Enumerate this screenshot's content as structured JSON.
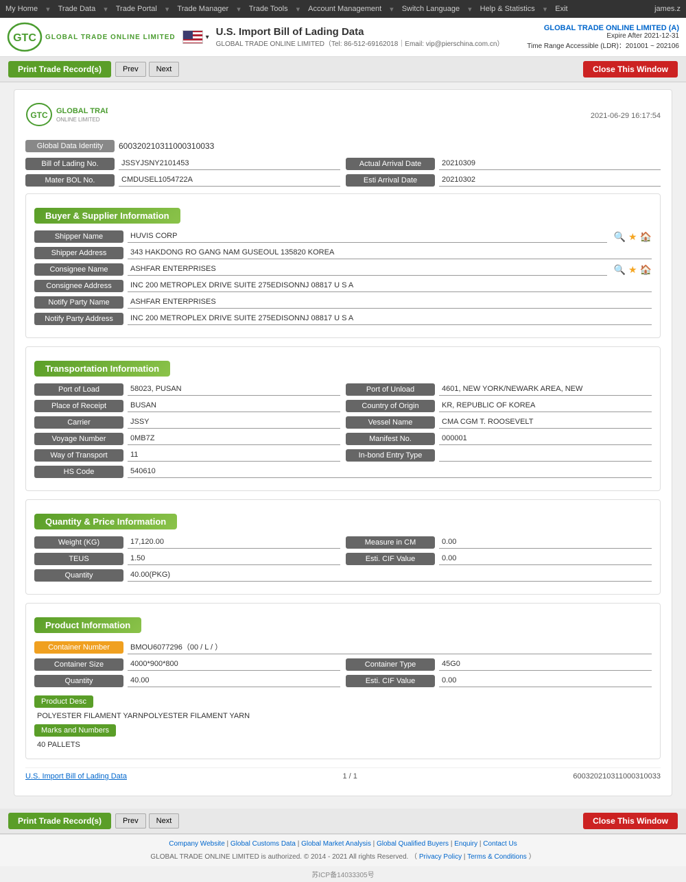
{
  "topnav": {
    "items": [
      "My Home",
      "Trade Data",
      "Trade Portal",
      "Trade Manager",
      "Trade Tools",
      "Account Management",
      "Switch Language",
      "Help & Statistics",
      "Exit"
    ],
    "user": "james.z"
  },
  "header": {
    "logo_text": "GTC",
    "logo_sub": "GLOBAL TRADE ONLINE LIMITED",
    "flag_alt": "US Flag",
    "title": "U.S. Import Bill of Lading Data",
    "subtitle": "GLOBAL TRADE ONLINE LIMITED（Tel: 86-512-69162018｜Email: vip@pierschina.com.cn）",
    "company_link": "GLOBAL TRADE ONLINE LIMITED (A)",
    "expire": "Expire After 2021-12-31",
    "time_range": "Time Range Accessible (LDR)：201001 ~ 202106"
  },
  "toolbar": {
    "print_label": "Print Trade Record(s)",
    "prev_label": "Prev",
    "next_label": "Next",
    "close_label": "Close This Window"
  },
  "record": {
    "datetime": "2021-06-29 16:17:54",
    "global_data_identity_label": "Global Data Identity",
    "global_data_identity_value": "600320210311000310033",
    "bol_no_label": "Bill of Lading No.",
    "bol_no_value": "JSSYJSNY2101453",
    "actual_arrival_label": "Actual Arrival Date",
    "actual_arrival_value": "20210309",
    "mater_bol_label": "Mater BOL No.",
    "mater_bol_value": "CMDUSEL1054722A",
    "esti_arrival_label": "Esti Arrival Date",
    "esti_arrival_value": "20210302"
  },
  "buyer_supplier": {
    "section_title": "Buyer & Supplier Information",
    "shipper_name_label": "Shipper Name",
    "shipper_name_value": "HUVIS CORP",
    "shipper_address_label": "Shipper Address",
    "shipper_address_value": "343 HAKDONG RO GANG NAM GUSEOUL 135820 KOREA",
    "consignee_name_label": "Consignee Name",
    "consignee_name_value": "ASHFAR ENTERPRISES",
    "consignee_address_label": "Consignee Address",
    "consignee_address_value": "INC 200 METROPLEX DRIVE SUITE 275EDISONNJ 08817 U S A",
    "notify_party_name_label": "Notify Party Name",
    "notify_party_name_value": "ASHFAR ENTERPRISES",
    "notify_party_address_label": "Notify Party Address",
    "notify_party_address_value": "INC 200 METROPLEX DRIVE SUITE 275EDISONNJ 08817 U S A"
  },
  "transportation": {
    "section_title": "Transportation Information",
    "port_of_load_label": "Port of Load",
    "port_of_load_value": "58023, PUSAN",
    "port_of_unload_label": "Port of Unload",
    "port_of_unload_value": "4601, NEW YORK/NEWARK AREA, NEW",
    "place_of_receipt_label": "Place of Receipt",
    "place_of_receipt_value": "BUSAN",
    "country_of_origin_label": "Country of Origin",
    "country_of_origin_value": "KR, REPUBLIC OF KOREA",
    "carrier_label": "Carrier",
    "carrier_value": "JSSY",
    "vessel_name_label": "Vessel Name",
    "vessel_name_value": "CMA CGM T. ROOSEVELT",
    "voyage_number_label": "Voyage Number",
    "voyage_number_value": "0MB7Z",
    "manifest_no_label": "Manifest No.",
    "manifest_no_value": "000001",
    "way_of_transport_label": "Way of Transport",
    "way_of_transport_value": "11",
    "in_bond_entry_label": "In-bond Entry Type",
    "in_bond_entry_value": "",
    "hs_code_label": "HS Code",
    "hs_code_value": "540610"
  },
  "quantity_price": {
    "section_title": "Quantity & Price Information",
    "weight_label": "Weight (KG)",
    "weight_value": "17,120.00",
    "measure_cm_label": "Measure in CM",
    "measure_cm_value": "0.00",
    "teus_label": "TEUS",
    "teus_value": "1.50",
    "esti_cif_label": "Esti. CIF Value",
    "esti_cif_value": "0.00",
    "quantity_label": "Quantity",
    "quantity_value": "40.00(PKG)"
  },
  "product": {
    "section_title": "Product Information",
    "container_number_label": "Container Number",
    "container_number_value": "BMOU6077296（00 / L / ）",
    "container_size_label": "Container Size",
    "container_size_value": "4000*900*800",
    "container_type_label": "Container Type",
    "container_type_value": "45G0",
    "quantity_label": "Quantity",
    "quantity_value": "40.00",
    "esti_cif_label": "Esti. CIF Value",
    "esti_cif_value": "0.00",
    "product_desc_label": "Product Desc",
    "product_desc_value": "POLYESTER FILAMENT YARNPOLYESTER FILAMENT YARN",
    "marks_label": "Marks and Numbers",
    "marks_value": "40 PALLETS"
  },
  "record_footer": {
    "link_text": "U.S. Import Bill of Lading Data",
    "page_info": "1 / 1",
    "record_id": "600320210311000310033"
  },
  "page_footer": {
    "links": [
      "Company Website",
      "Global Customs Data",
      "Global Market Analysis",
      "Global Qualified Buyers",
      "Enquiry",
      "Contact Us"
    ],
    "copyright": "GLOBAL TRADE ONLINE LIMITED is authorized. © 2014 - 2021 All rights Reserved.  （",
    "privacy": "Privacy Policy",
    "pipe": "|",
    "terms": "Terms & Conditions",
    "close_paren": "）",
    "icp": "苏ICP备14033305号"
  }
}
